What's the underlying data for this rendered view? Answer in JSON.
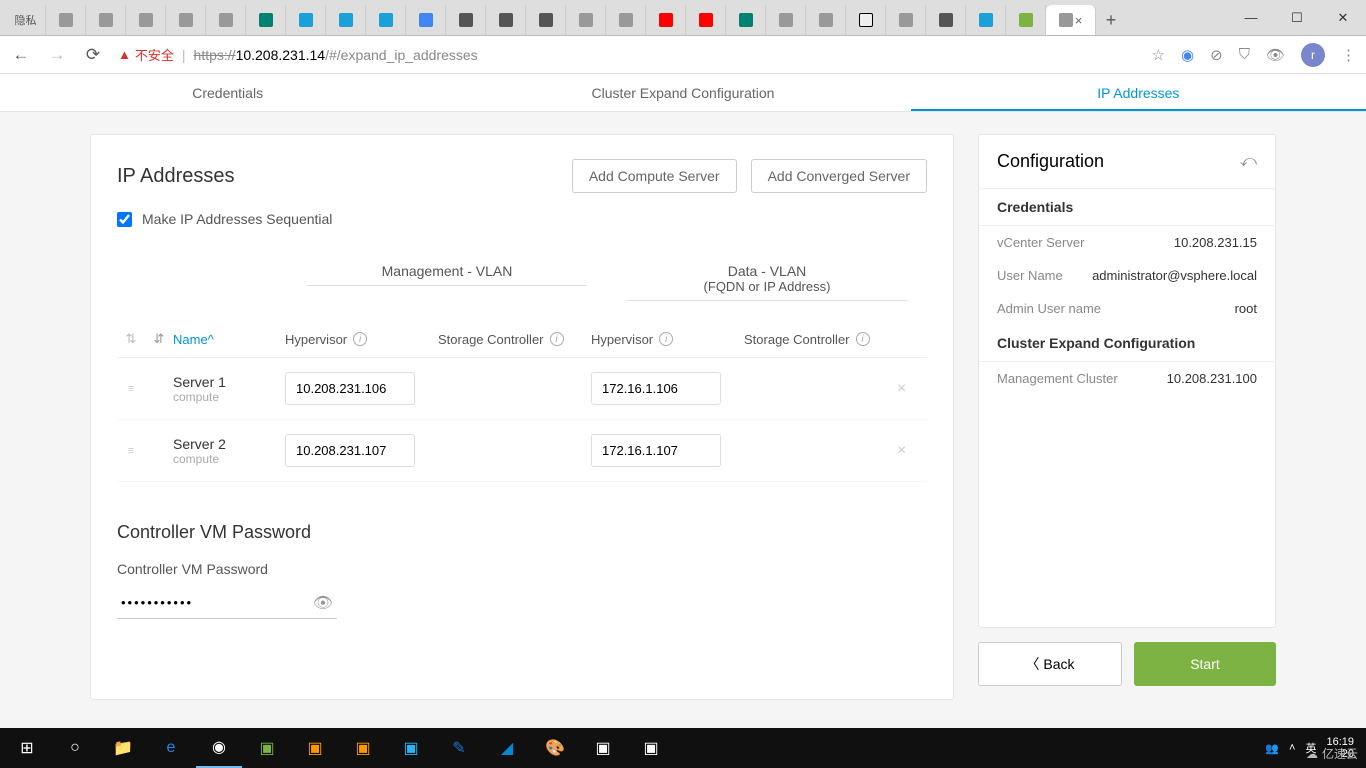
{
  "browser": {
    "insecure_label": "不安全",
    "incognito_label": "隐私",
    "url_protocol": "https",
    "url_host": "10.208.231.14",
    "url_path": "/#/expand_ip_addresses",
    "avatar_letter": "r"
  },
  "tabs": {
    "credentials": "Credentials",
    "cluster_expand": "Cluster Expand Configuration",
    "ip_addresses": "IP Addresses"
  },
  "main": {
    "title": "IP Addresses",
    "add_compute": "Add Compute Server",
    "add_converged": "Add Converged Server",
    "sequential_label": "Make IP Addresses Sequential",
    "mgmt_vlan": "Management - VLAN",
    "data_vlan": "Data - VLAN",
    "data_vlan_sub": "(FQDN or IP Address)",
    "col_name": "Name",
    "col_hypervisor": "Hypervisor",
    "col_storage": "Storage Controller",
    "rows": [
      {
        "name": "Server 1",
        "type": "compute",
        "mgmt_hyp": "10.208.231.106",
        "data_hyp": "172.16.1.106"
      },
      {
        "name": "Server 2",
        "type": "compute",
        "mgmt_hyp": "10.208.231.107",
        "data_hyp": "172.16.1.107"
      }
    ],
    "pwd_title": "Controller VM Password",
    "pwd_label": "Controller VM Password",
    "pwd_value": "•••••••••••"
  },
  "sidebar": {
    "title": "Configuration",
    "credentials_title": "Credentials",
    "vcenter_label": "vCenter Server",
    "vcenter_value": "10.208.231.15",
    "username_label": "User Name",
    "username_value": "administrator@vsphere.local",
    "admin_label": "Admin User name",
    "admin_value": "root",
    "cluster_title": "Cluster Expand Configuration",
    "mgmt_cluster_label": "Management Cluster",
    "mgmt_cluster_value": "10.208.231.100",
    "back_label": "Back",
    "start_label": "Start"
  },
  "taskbar": {
    "time": "16:19",
    "lang1": "英",
    "date_partial": "20",
    "watermark": "亿速云"
  }
}
